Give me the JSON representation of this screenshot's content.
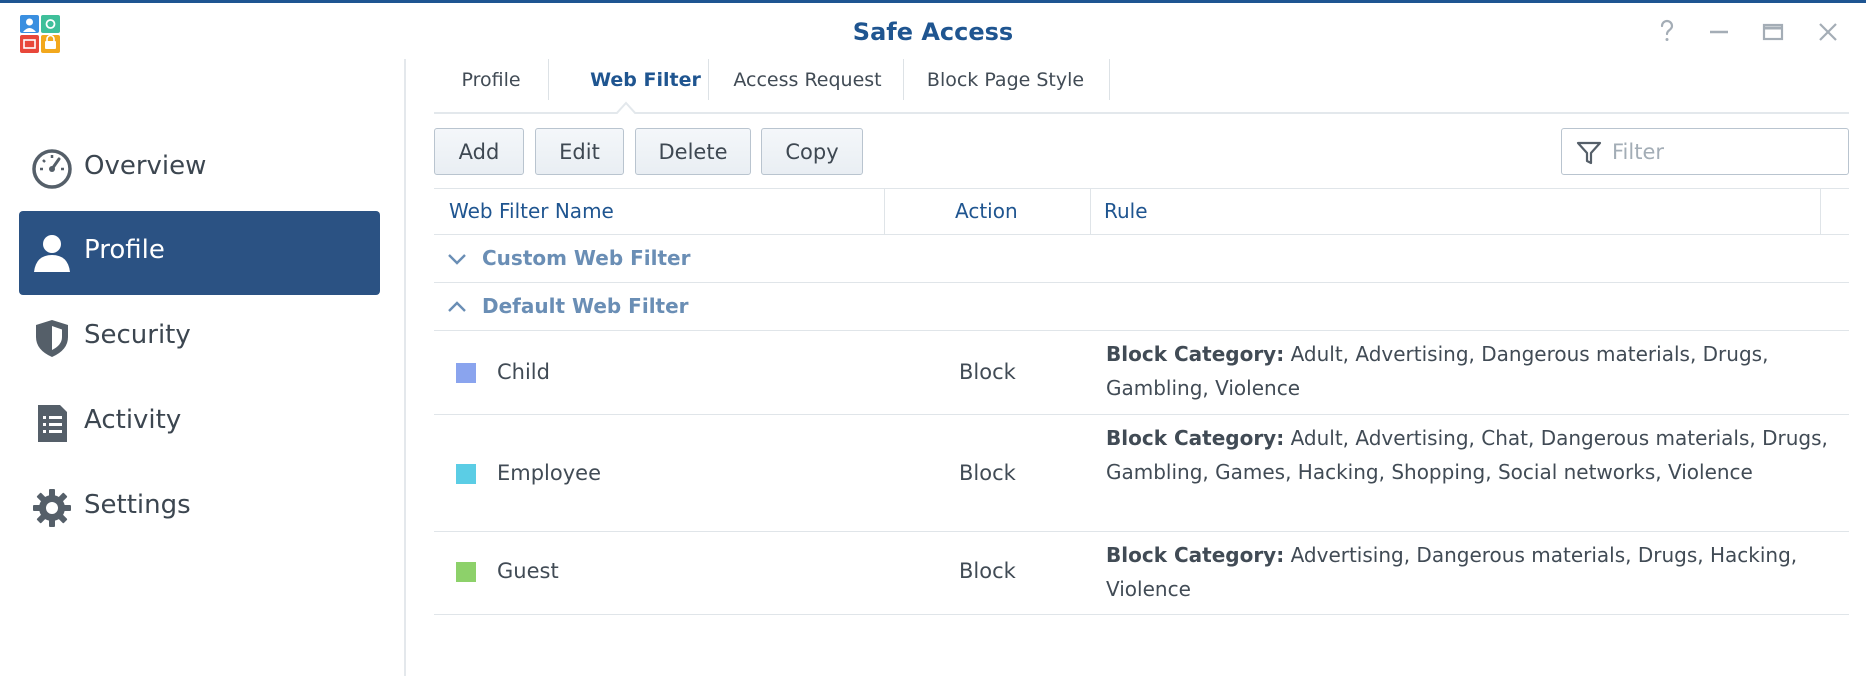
{
  "window": {
    "title": "Safe Access"
  },
  "sidebar": {
    "items": [
      {
        "label": "Overview",
        "icon": "gauge-icon"
      },
      {
        "label": "Profile",
        "icon": "user-icon"
      },
      {
        "label": "Security",
        "icon": "shield-icon"
      },
      {
        "label": "Activity",
        "icon": "report-icon"
      },
      {
        "label": "Settings",
        "icon": "gear-icon"
      }
    ],
    "active": "Profile"
  },
  "tabs": [
    {
      "label": "Profile"
    },
    {
      "label": "Web Filter"
    },
    {
      "label": "Access Request"
    },
    {
      "label": "Block Page Style"
    }
  ],
  "active_tab": "Web Filter",
  "toolbar": {
    "add": "Add",
    "edit": "Edit",
    "delete": "Delete",
    "copy": "Copy",
    "filter_placeholder": "Filter"
  },
  "table": {
    "columns": [
      "Web Filter Name",
      "Action",
      "Rule"
    ],
    "groups": [
      {
        "label": "Custom Web Filter",
        "expanded": false
      },
      {
        "label": "Default Web Filter",
        "expanded": true
      }
    ],
    "rows": [
      {
        "name": "Child",
        "color": "#8aa4ee",
        "action": "Block",
        "rule_label": "Block Category:",
        "rule_value": "Adult, Advertising, Dangerous materials, Drugs, Gambling, Violence"
      },
      {
        "name": "Employee",
        "color": "#5bcde5",
        "action": "Block",
        "rule_label": "Block Category:",
        "rule_value": "Adult, Advertising, Chat, Dangerous materials, Drugs, Gambling, Games, Hacking, Shopping, Social networks, Violence"
      },
      {
        "name": "Guest",
        "color": "#8dd16a",
        "action": "Block",
        "rule_label": "Block Category:",
        "rule_value": "Advertising, Dangerous materials, Drugs, Hacking, Violence"
      }
    ]
  },
  "colors": {
    "accent": "#1f5590",
    "sidebar_active": "#2b5283",
    "group_label": "#6a8eb5"
  }
}
